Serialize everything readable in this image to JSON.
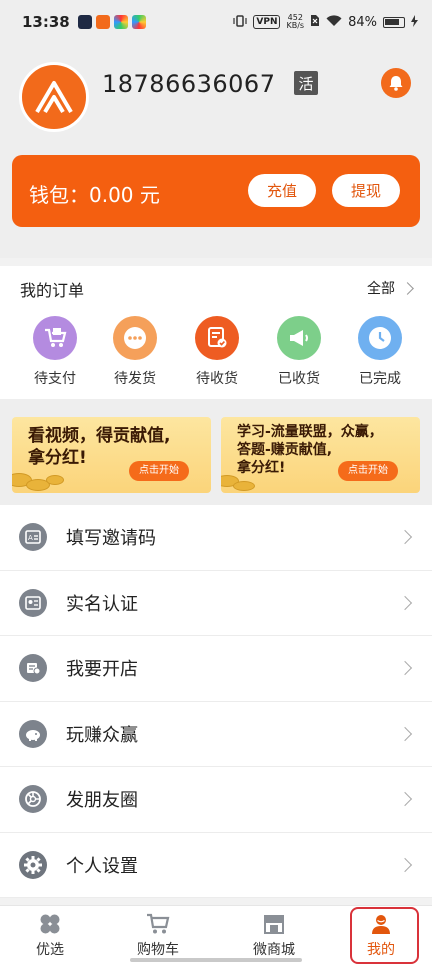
{
  "status_bar": {
    "time": "13:38",
    "vpn": "VPN",
    "net_speed_value": "452",
    "net_speed_unit": "KB/s",
    "battery": "84%"
  },
  "profile": {
    "phone": "18786636067",
    "badge": "活"
  },
  "wallet": {
    "label": "钱包：0.00 元",
    "recharge": "充值",
    "withdraw": "提现"
  },
  "orders": {
    "title": "我的订单",
    "all": "全部",
    "items": [
      {
        "label": "待支付",
        "color": "#b48be0"
      },
      {
        "label": "待发货",
        "color": "#f5a05a"
      },
      {
        "label": "待收货",
        "color": "#ee5c22"
      },
      {
        "label": "已收货",
        "color": "#7dcf8a"
      },
      {
        "label": "已完成",
        "color": "#6fb0f0"
      }
    ]
  },
  "banners": [
    {
      "line1": "看视频，得贡献值,",
      "line2": "拿分红!",
      "button": "点击开始"
    },
    {
      "line1": "学习-流量联盟，众赢，",
      "line2": "答题-赚贡献值,",
      "line3": "拿分红!",
      "button": "点击开始"
    }
  ],
  "menu": [
    {
      "label": "填写邀请码",
      "icon": "invite-code-icon"
    },
    {
      "label": "实名认证",
      "icon": "id-card-icon"
    },
    {
      "label": "我要开店",
      "icon": "open-shop-icon"
    },
    {
      "label": "玩赚众赢",
      "icon": "piggy-bank-icon"
    },
    {
      "label": "发朋友圈",
      "icon": "moments-icon"
    },
    {
      "label": "个人设置",
      "icon": "gear-icon"
    }
  ],
  "tabs": [
    {
      "label": "优选"
    },
    {
      "label": "购物车"
    },
    {
      "label": "微商城"
    },
    {
      "label": "我的"
    }
  ],
  "colors": {
    "accent": "#f45f10",
    "tab_active": "#e2560d"
  }
}
